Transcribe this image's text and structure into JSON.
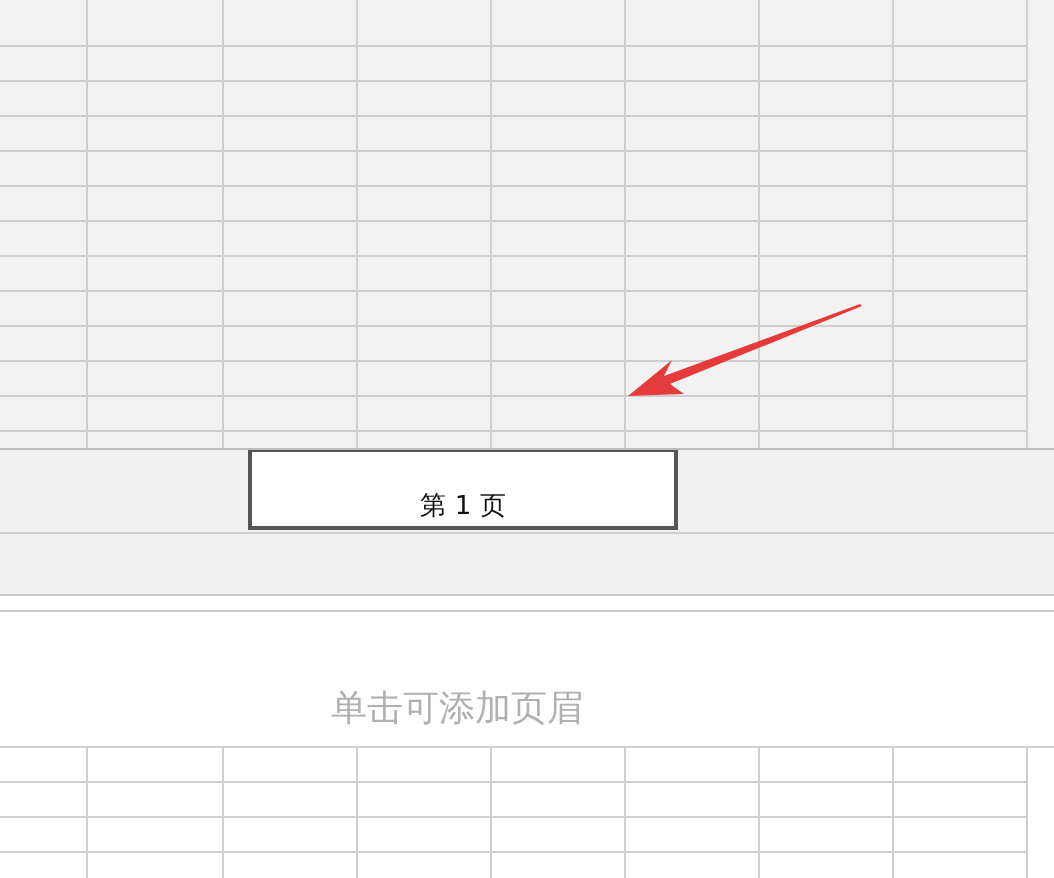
{
  "page_footer": {
    "text": "第 1 页"
  },
  "next_page_header": {
    "placeholder": "单击可添加页眉"
  }
}
